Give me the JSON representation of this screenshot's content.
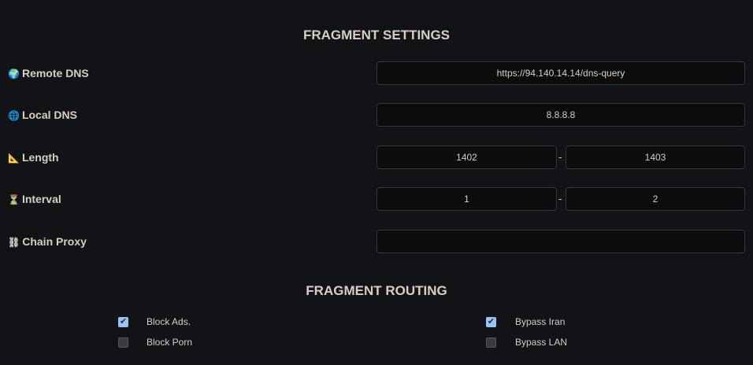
{
  "fragment_settings": {
    "title": "FRAGMENT SETTINGS",
    "remote_dns": {
      "icon": "globe-europe-icon",
      "emoji": "🌍",
      "label": "Remote DNS",
      "value": "https://94.140.14.14/dns-query"
    },
    "local_dns": {
      "icon": "globe-meridians-icon",
      "emoji": "🌐",
      "label": "Local DNS",
      "value": "8.8.8.8"
    },
    "length": {
      "icon": "triangular-ruler-icon",
      "emoji": "📐",
      "label": "Length",
      "min": "1402",
      "max": "1403",
      "sep": "-"
    },
    "interval": {
      "icon": "hourglass-icon",
      "emoji": "⏳",
      "label": "Interval",
      "min": "1",
      "max": "2",
      "sep": "-"
    },
    "chain_proxy": {
      "icon": "chains-icon",
      "emoji": "⛓",
      "label": "Chain Proxy",
      "value": ""
    }
  },
  "fragment_routing": {
    "title": "FRAGMENT ROUTING",
    "items": [
      {
        "label": "Block Ads.",
        "checked": true
      },
      {
        "label": "Block Porn",
        "checked": false
      },
      {
        "label": "Bypass Iran",
        "checked": true
      },
      {
        "label": "Bypass LAN",
        "checked": false
      }
    ]
  }
}
